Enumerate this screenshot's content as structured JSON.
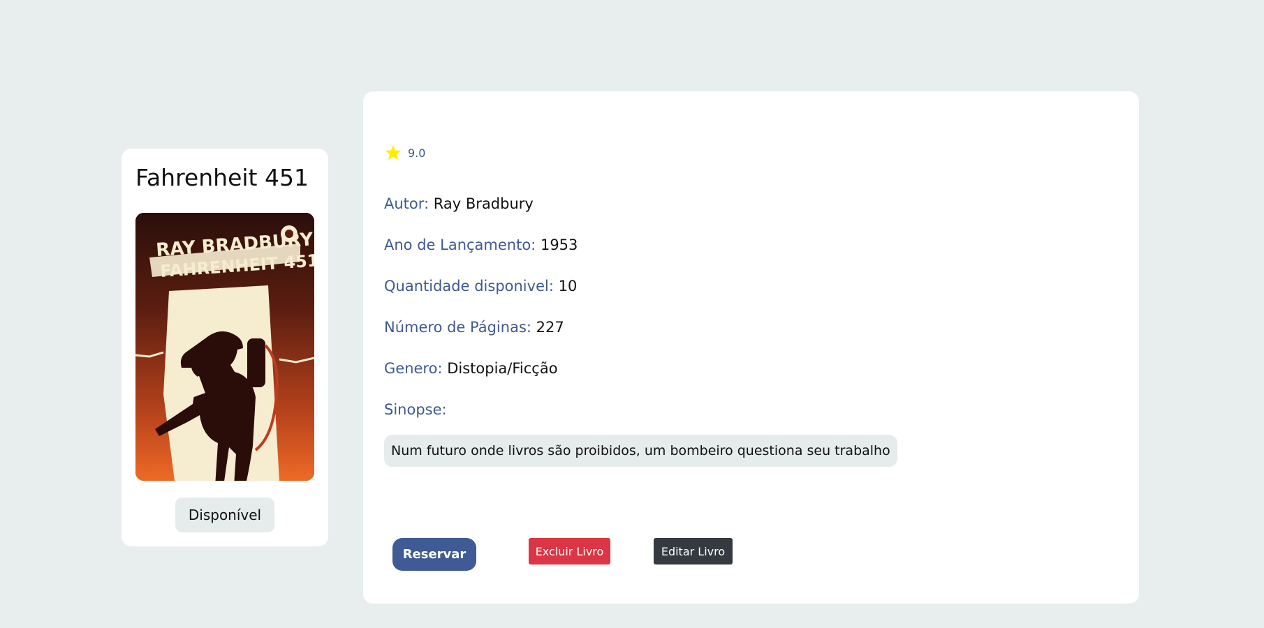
{
  "book": {
    "title": "Fahrenheit 451",
    "cover": {
      "author_text": "RAY BRADBURY",
      "title_text": "FAHRENHEIT 451",
      "colors": {
        "top": "#2b0f0a",
        "bottom": "#e8652a",
        "paper": "#f6ecd0"
      }
    },
    "status": "Disponível"
  },
  "details": {
    "rating": {
      "icon": "star-icon",
      "value": "9.0",
      "color": "#ffee00"
    },
    "fields": {
      "author": {
        "label": "Autor:",
        "value": "Ray Bradbury"
      },
      "year": {
        "label": "Ano de Lançamento:",
        "value": "1953"
      },
      "quantity": {
        "label": "Quantidade disponivel:",
        "value": "10"
      },
      "pages": {
        "label": "Número de Páginas:",
        "value": "227"
      },
      "genre": {
        "label": "Genero:",
        "value": "Distopia/Ficção"
      },
      "synopsis": {
        "label": "Sinopse:",
        "value": "Num futuro onde livros são proibidos, um bombeiro questiona seu trabalho"
      }
    }
  },
  "actions": {
    "reserve": {
      "label": "Reservar",
      "color": "#3f5a94"
    },
    "delete": {
      "label": "Excluir Livro",
      "color": "#dc3545"
    },
    "edit": {
      "label": "Editar Livro",
      "color": "#343a40"
    }
  }
}
